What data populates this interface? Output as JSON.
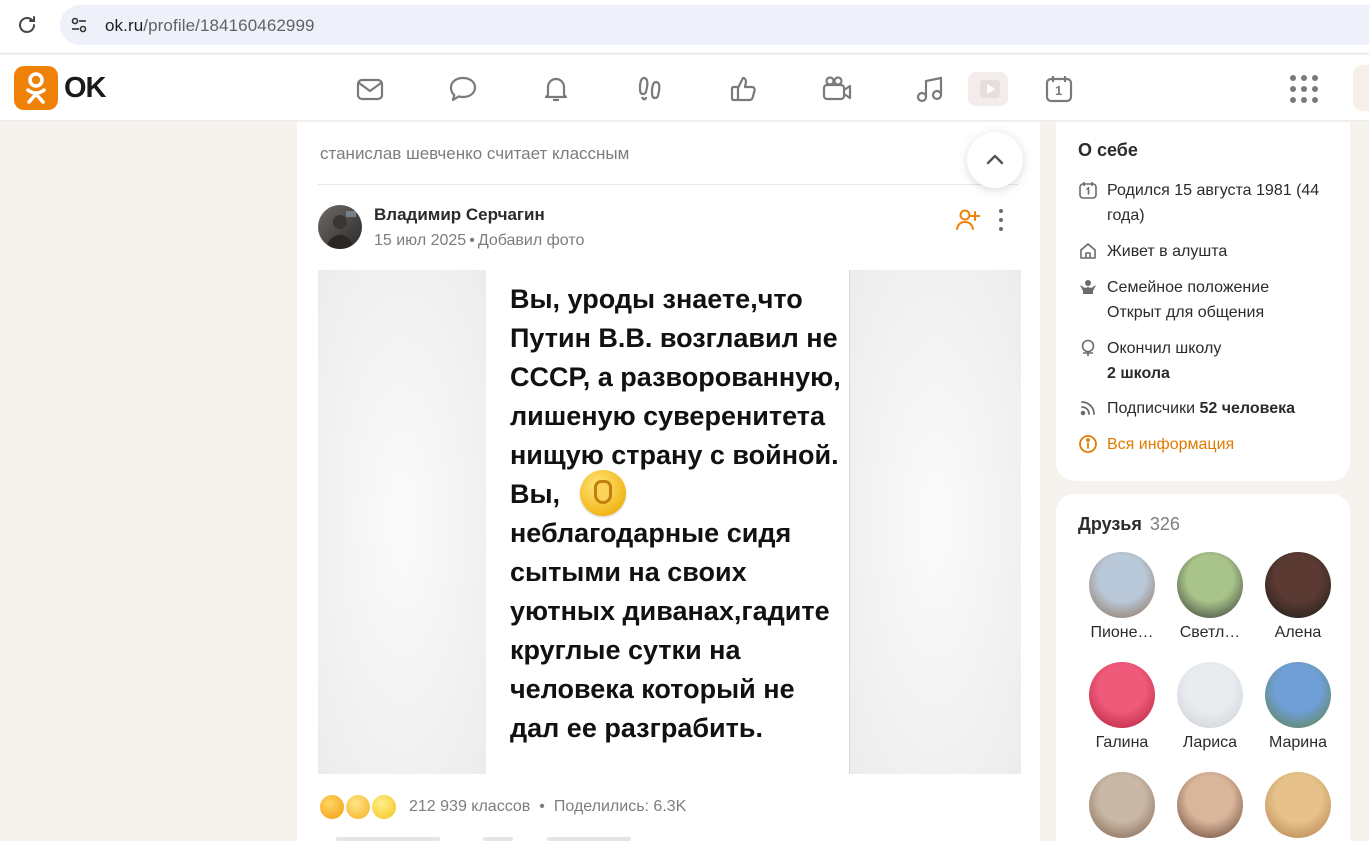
{
  "browser": {
    "url_host": "ok.ru",
    "url_path": "/profile/184160462999"
  },
  "header": {
    "logo_text": "OK",
    "nav_icons": [
      "mail-icon",
      "chat-icon",
      "bell-icon",
      "footprints-icon",
      "like-icon",
      "video-camera-icon",
      "music-icon",
      "play-icon",
      "calendar-icon"
    ],
    "calendar_day": "1"
  },
  "feed": {
    "liked_by_line": "станислав шевченко считает классным",
    "post": {
      "author": "Владимир Серчагин",
      "date": "15 июл 2025",
      "action": "Добавил фото",
      "photo_text": "Вы, уроды знаете,что\nПутин В.В. возглавил не\nСССР, а разворованную,\nлишеную суверенитета\nнищую страну с войной.\nВы,\nнеблагодарные сидя\nсытыми на своих\nуютных диванах,гадите\nкруглые сутки на\nчеловека который не\nдал ее разграбить.",
      "classes_count": "212 939 классов",
      "shares": "Поделились: 6.3K"
    }
  },
  "about": {
    "title": "О себе",
    "born": "Родился 15 августа 1981 (44 года)",
    "lives": "Живет в алушта",
    "family_label": "Семейное положение",
    "family_value": "Открыт для общения",
    "school_label": "Окончил школу",
    "school_value": "2 школа",
    "subscribers_label": "Подписчики",
    "subscribers_value": "52 человека",
    "all_info": "Вся информация"
  },
  "friends": {
    "title": "Друзья",
    "count": "326",
    "items": [
      {
        "name": "Пионе…",
        "color1": "#b9c9d9",
        "color2": "#8a6a4e"
      },
      {
        "name": "Светл…",
        "color1": "#a8c48a",
        "color2": "#2f2f2f"
      },
      {
        "name": "Алена",
        "color1": "#5a3a32",
        "color2": "#1a1a1a"
      },
      {
        "name": "Галина",
        "color1": "#f05a7a",
        "color2": "#b01c3a"
      },
      {
        "name": "Лариса",
        "color1": "#e9ecef",
        "color2": "#c8cfd6"
      },
      {
        "name": "Марина",
        "color1": "#6f9fd6",
        "color2": "#5f7f3f"
      },
      {
        "name": "",
        "color1": "#c9b8a6",
        "color2": "#7a5a45"
      },
      {
        "name": "",
        "color1": "#d9b59a",
        "color2": "#5a3a2a"
      },
      {
        "name": "",
        "color1": "#e6c28a",
        "color2": "#b07a4a"
      }
    ]
  }
}
